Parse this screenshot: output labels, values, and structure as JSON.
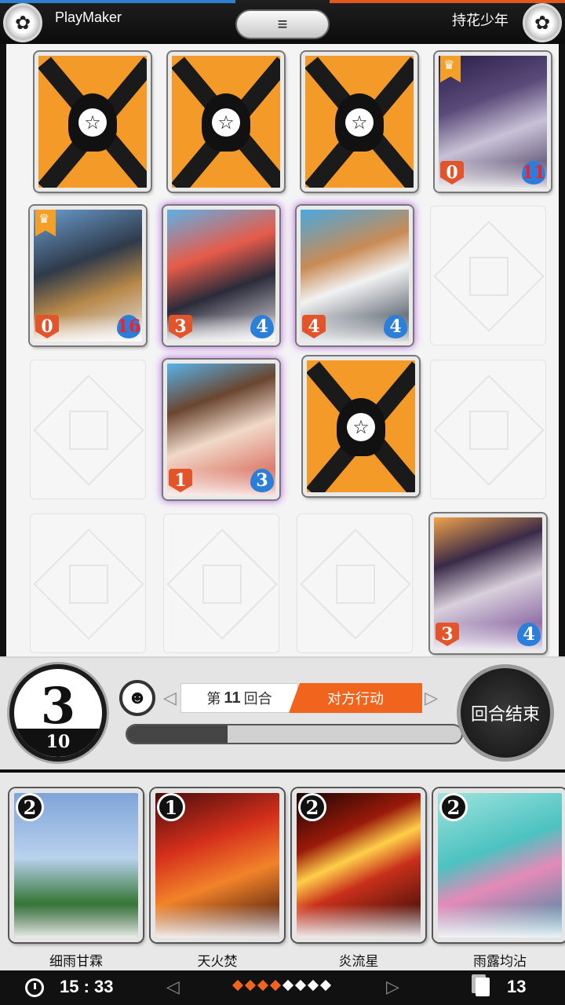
{
  "top_bar": {
    "left_player": "PlayMaker",
    "right_player": "持花少年",
    "menu_icon": "≡"
  },
  "board": {
    "opponent_row": [
      {
        "type": "card-back"
      },
      {
        "type": "card-back"
      },
      {
        "type": "card-back"
      },
      {
        "type": "unit",
        "attack": "0",
        "health": "11",
        "art": "witch-reading-book",
        "rank": "crown"
      }
    ],
    "row2": [
      {
        "type": "unit",
        "attack": "0",
        "health": "16",
        "art": "dark-haired-man",
        "rank": "crown"
      },
      {
        "type": "unit",
        "attack": "3",
        "health": "4",
        "art": "red-haired-swordsman"
      },
      {
        "type": "unit",
        "attack": "4",
        "health": "4",
        "art": "beast-eared-girl"
      },
      {
        "type": "empty"
      }
    ],
    "row3": [
      {
        "type": "empty"
      },
      {
        "type": "unit",
        "attack": "1",
        "health": "3",
        "art": "girl-ponytail"
      },
      {
        "type": "card-back"
      },
      {
        "type": "empty"
      }
    ],
    "row4": [
      {
        "type": "empty"
      },
      {
        "type": "empty"
      },
      {
        "type": "empty"
      },
      {
        "type": "unit",
        "attack": "3",
        "health": "4",
        "art": "horned-girl"
      }
    ]
  },
  "hud": {
    "mana_current": "3",
    "mana_max": "10",
    "emote_icon": "☻",
    "round_prefix": "第",
    "round_number": "11",
    "round_suffix": "回合",
    "turn_state": "对方行动",
    "timer_progress": 0.3,
    "end_turn_label": "回合结束"
  },
  "hand": [
    {
      "name": "细雨甘霖",
      "cost": "2",
      "art": "rain-forest"
    },
    {
      "name": "天火焚",
      "cost": "1",
      "art": "fire-dragon"
    },
    {
      "name": "炎流星",
      "cost": "2",
      "art": "meteor"
    },
    {
      "name": "雨露均沾",
      "cost": "2",
      "art": "lotus-pond"
    }
  ],
  "bottom_bar": {
    "time": "15 : 33",
    "deck_count": "13",
    "page_dots_active": 4,
    "page_dots_total": 8
  },
  "colors": {
    "accent_orange": "#f0641e",
    "attack_red": "#e4542a",
    "health_blue": "#2b7fd8",
    "card_back_orange": "#f39a28"
  }
}
